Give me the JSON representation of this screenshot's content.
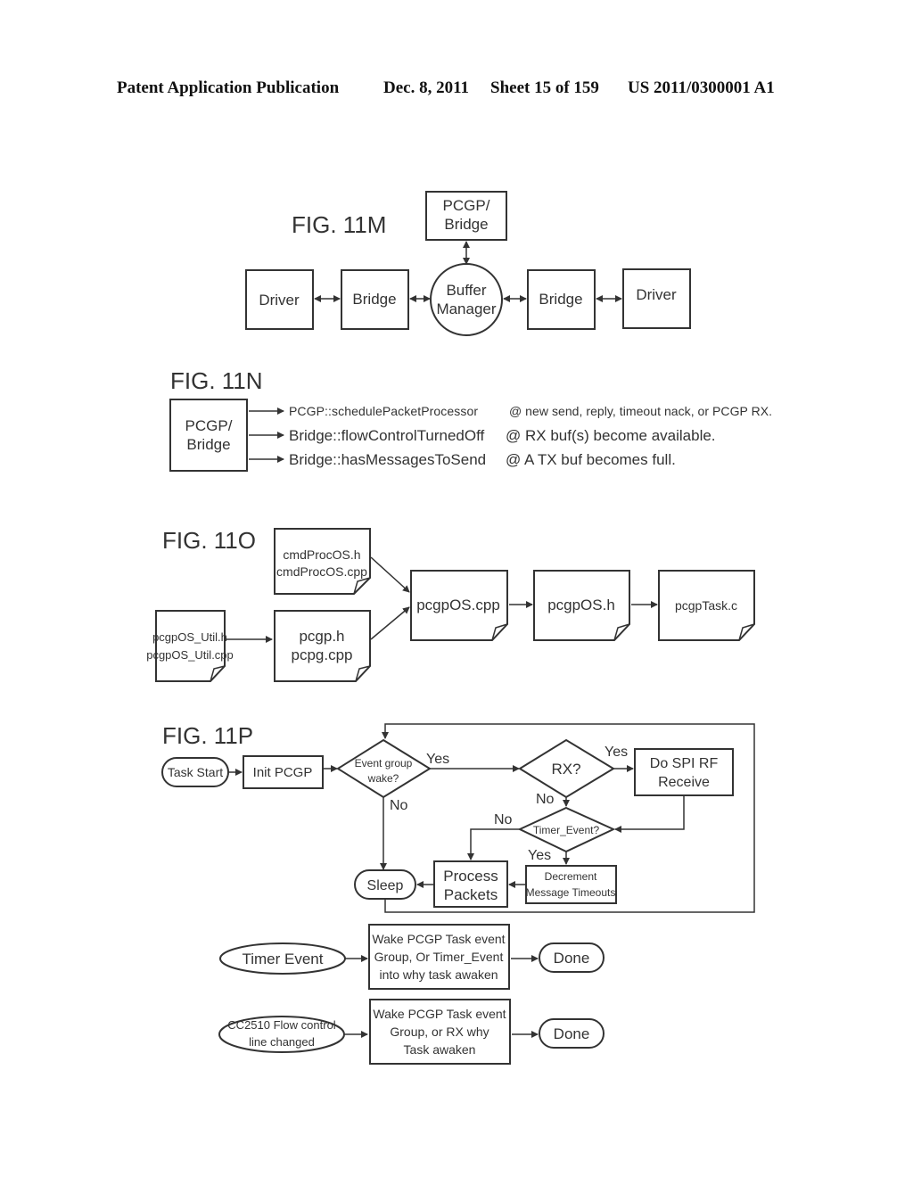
{
  "header": {
    "publication": "Patent Application Publication",
    "date": "Dec. 8, 2011",
    "sheet": "Sheet 15 of 159",
    "number": "US 2011/0300001 A1"
  },
  "fig11m": {
    "title": "FIG. 11M",
    "top": [
      "PCGP/",
      "Bridge"
    ],
    "left_driver": "Driver",
    "left_bridge": "Bridge",
    "center": [
      "Buffer",
      "Manager"
    ],
    "right_bridge": "Bridge",
    "right_driver": "Driver"
  },
  "fig11n": {
    "title": "FIG. 11N",
    "box": [
      "PCGP/",
      "Bridge"
    ],
    "rows": [
      {
        "call": "PCGP::schedulePacketProcessor",
        "when": "@ new send, reply, timeout nack, or PCGP RX."
      },
      {
        "call": "Bridge::flowControlTurnedOff",
        "when": "@ RX buf(s) become available."
      },
      {
        "call": "Bridge::hasMessagesToSend",
        "when": "@ A TX buf becomes full."
      }
    ]
  },
  "fig11o": {
    "title": "FIG. 11O",
    "cmdproc": [
      "cmdProcOS.h",
      "cmdProcOS.cpp"
    ],
    "util": [
      "pcgpOS_Util.h",
      "pcgpOS_Util.cpp"
    ],
    "pcgp": [
      "pcgp.h",
      "pcpg.cpp"
    ],
    "oscpp": "pcgpOS.cpp",
    "osh": "pcgpOS.h",
    "task": "pcgpTask.c"
  },
  "fig11p": {
    "title": "FIG. 11P",
    "task_start": "Task Start",
    "init": "Init PCGP",
    "event_wake": [
      "Event group",
      "wake?"
    ],
    "yes1": "Yes",
    "no1": "No",
    "rx": "RX?",
    "yes2": "Yes",
    "no2": "No",
    "spi": [
      "Do SPI RF",
      "Receive"
    ],
    "timer_q": "Timer_Event?",
    "no3": "No",
    "yes3": "Yes",
    "decrement": [
      "Decrement",
      "Message Timeouts"
    ],
    "process": [
      "Process",
      "Packets"
    ],
    "sleep": "Sleep",
    "timer_event": "Timer Event",
    "wake1": [
      "Wake PCGP Task event",
      "Group, Or Timer_Event",
      "into why task awaken"
    ],
    "done1": "Done",
    "cc2510": [
      "CC2510 Flow control",
      "line changed"
    ],
    "wake2": [
      "Wake PCGP Task event",
      "Group, or RX why",
      "Task awaken"
    ],
    "done2": "Done"
  }
}
